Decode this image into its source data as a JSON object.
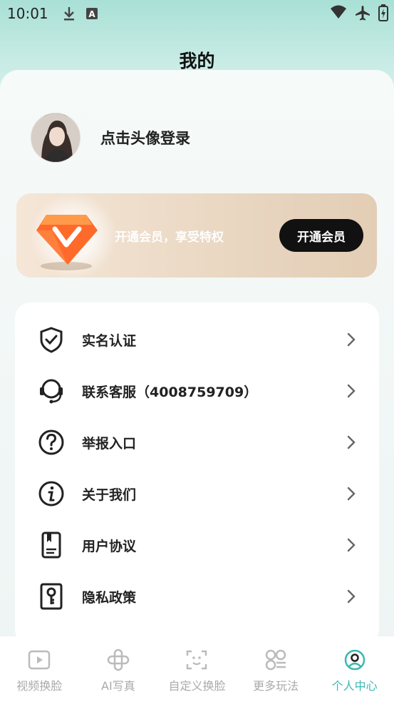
{
  "status_bar": {
    "time": "10:01",
    "left_icons": [
      "download-icon",
      "font-a-icon"
    ],
    "right_icons": [
      "wifi-icon",
      "airplane-icon",
      "battery-icon"
    ]
  },
  "header": {
    "title": "我的"
  },
  "profile": {
    "label": "点击头像登录"
  },
  "vip": {
    "text": "开通会员，享受特权",
    "button_label": "开通会员",
    "accent_color": "#ff6a2b"
  },
  "menu": {
    "items": [
      {
        "label": "实名认证",
        "icon": "shield-check-icon"
      },
      {
        "label": "联系客服（4008759709）",
        "icon": "headset-icon"
      },
      {
        "label": "举报入口",
        "icon": "question-icon"
      },
      {
        "label": "关于我们",
        "icon": "info-icon"
      },
      {
        "label": "用户协议",
        "icon": "agreement-icon"
      },
      {
        "label": "隐私政策",
        "icon": "privacy-key-icon"
      }
    ]
  },
  "tabbar": {
    "active_color": "#3cb8b2",
    "inactive_color": "#aaaaaa",
    "items": [
      {
        "label": "视频换脸",
        "icon": "video-icon",
        "active": false
      },
      {
        "label": "AI写真",
        "icon": "ai-photo-icon",
        "active": false
      },
      {
        "label": "自定义换脸",
        "icon": "face-scan-icon",
        "active": false
      },
      {
        "label": "更多玩法",
        "icon": "grid-icon",
        "active": false
      },
      {
        "label": "个人中心",
        "icon": "profile-icon",
        "active": true
      }
    ]
  }
}
